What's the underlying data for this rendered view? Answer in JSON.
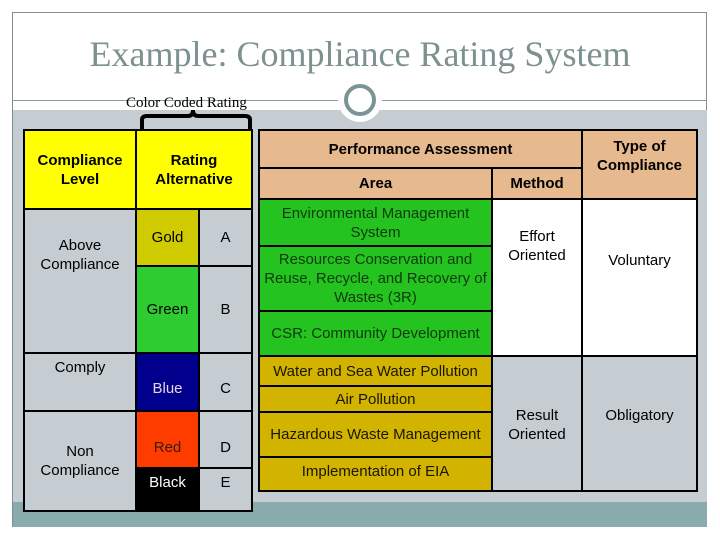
{
  "slide": {
    "title": "Example: Compliance Rating System",
    "caption": "Color Coded Rating"
  },
  "left_table": {
    "headers": {
      "compliance_level": "Compliance Level",
      "rating_alternative": "Rating Alternative"
    },
    "levels": [
      {
        "label": "Above Compliance"
      },
      {
        "label": "Comply"
      },
      {
        "label": "Non Compliance"
      }
    ],
    "ratings": [
      {
        "color": "Gold",
        "grade": "A",
        "hex": "#cfcb00"
      },
      {
        "color": "Green",
        "grade": "B",
        "hex": "#2ecc30"
      },
      {
        "color": "Blue",
        "grade": "C",
        "hex": "#00008c"
      },
      {
        "color": "Red",
        "grade": "D",
        "hex": "#ff3c00"
      },
      {
        "color": "Black",
        "grade": "E",
        "hex": "#000000"
      }
    ]
  },
  "right_table": {
    "headers": {
      "performance_assessment": "Performance Assessment",
      "area": "Area",
      "method": "Method",
      "type_of_compliance": "Type of Compliance"
    },
    "groups": [
      {
        "areas": [
          "Environmental Management System",
          "Resources Conservation and Reuse, Recycle, and Recovery of Wastes (3R)",
          "CSR: Community Development"
        ],
        "method": "Effort Oriented",
        "type": "Voluntary"
      },
      {
        "areas": [
          "Water and Sea Water Pollution",
          "Air Pollution",
          "Hazardous Waste Management",
          "Implementation of EIA"
        ],
        "method": "Result Oriented",
        "type": "Obligatory"
      }
    ]
  },
  "colors": {
    "header_yellow": "#ffff00",
    "header_tan": "#e6b98e",
    "effort_green": "#24c31f",
    "result_gold": "#d1b300",
    "title_gray": "#7d918f"
  }
}
